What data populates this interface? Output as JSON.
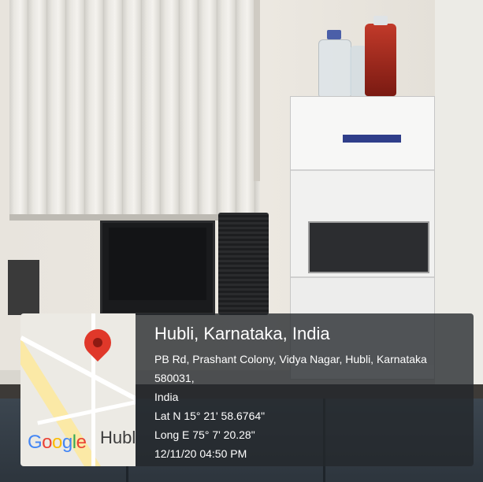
{
  "location": {
    "title": "Hubli, Karnataka, India",
    "address_line1": "PB Rd, Prashant Colony, Vidya Nagar, Hubli, Karnataka 580031,",
    "address_line2": "India",
    "latitude": "Lat N 15° 21' 58.6764\"",
    "longitude": "Long E 75° 7' 20.28\"",
    "timestamp": "12/11/20 04:50 PM"
  },
  "map": {
    "logo_text": "Google",
    "city_label": "Hubl",
    "pin_icon": "map-pin-icon",
    "pin_color": "#e0382a"
  },
  "colors": {
    "overlay_bg": "#24282c",
    "text": "#ffffff"
  }
}
